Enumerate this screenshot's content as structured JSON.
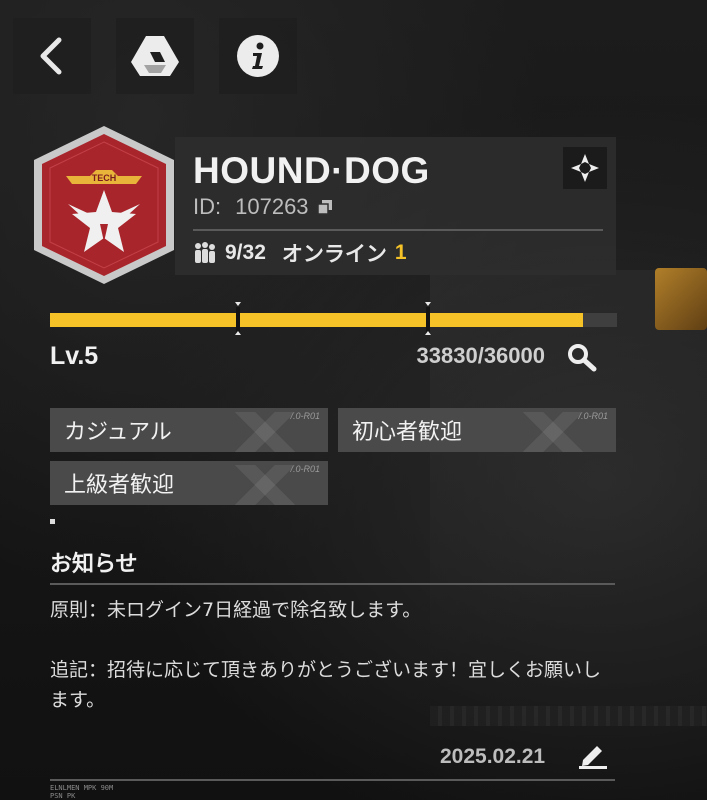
{
  "top_bar": {
    "back_icon": "chevron-left-icon",
    "drive_icon": "drive-triangle-icon",
    "info_icon": "info-icon"
  },
  "team": {
    "emblem_text": "TECH",
    "name": "HOUND·DOG",
    "id_label": "ID:",
    "id_value": "107263",
    "members": "9/32",
    "online_label": "オンライン",
    "online_count": "1"
  },
  "level": {
    "label": "Lv.5",
    "xp_text": "33830/36000",
    "progress": 0.94
  },
  "tags": [
    {
      "label": "カジュアル",
      "code": "/.0-R01"
    },
    {
      "label": "初心者歓迎",
      "code": "/.0-R01"
    },
    {
      "label": "上級者歓迎",
      "code": "/.0-R01"
    }
  ],
  "notice": {
    "title": "お知らせ",
    "body": "原則：未ログイン7日経過で除名致します。\n\n追記：招待に応じて頂きありがとうございます！宜しくお願いします。",
    "date": "2025.02.21"
  },
  "footer": {
    "tiny_text": "ELNLMEN MPK 90M\nPSN PK"
  },
  "colors": {
    "accent": "#f5c328",
    "panel": "#2e2e2e",
    "tag": "#4a4a4a",
    "emblem_red": "#a8252b"
  }
}
